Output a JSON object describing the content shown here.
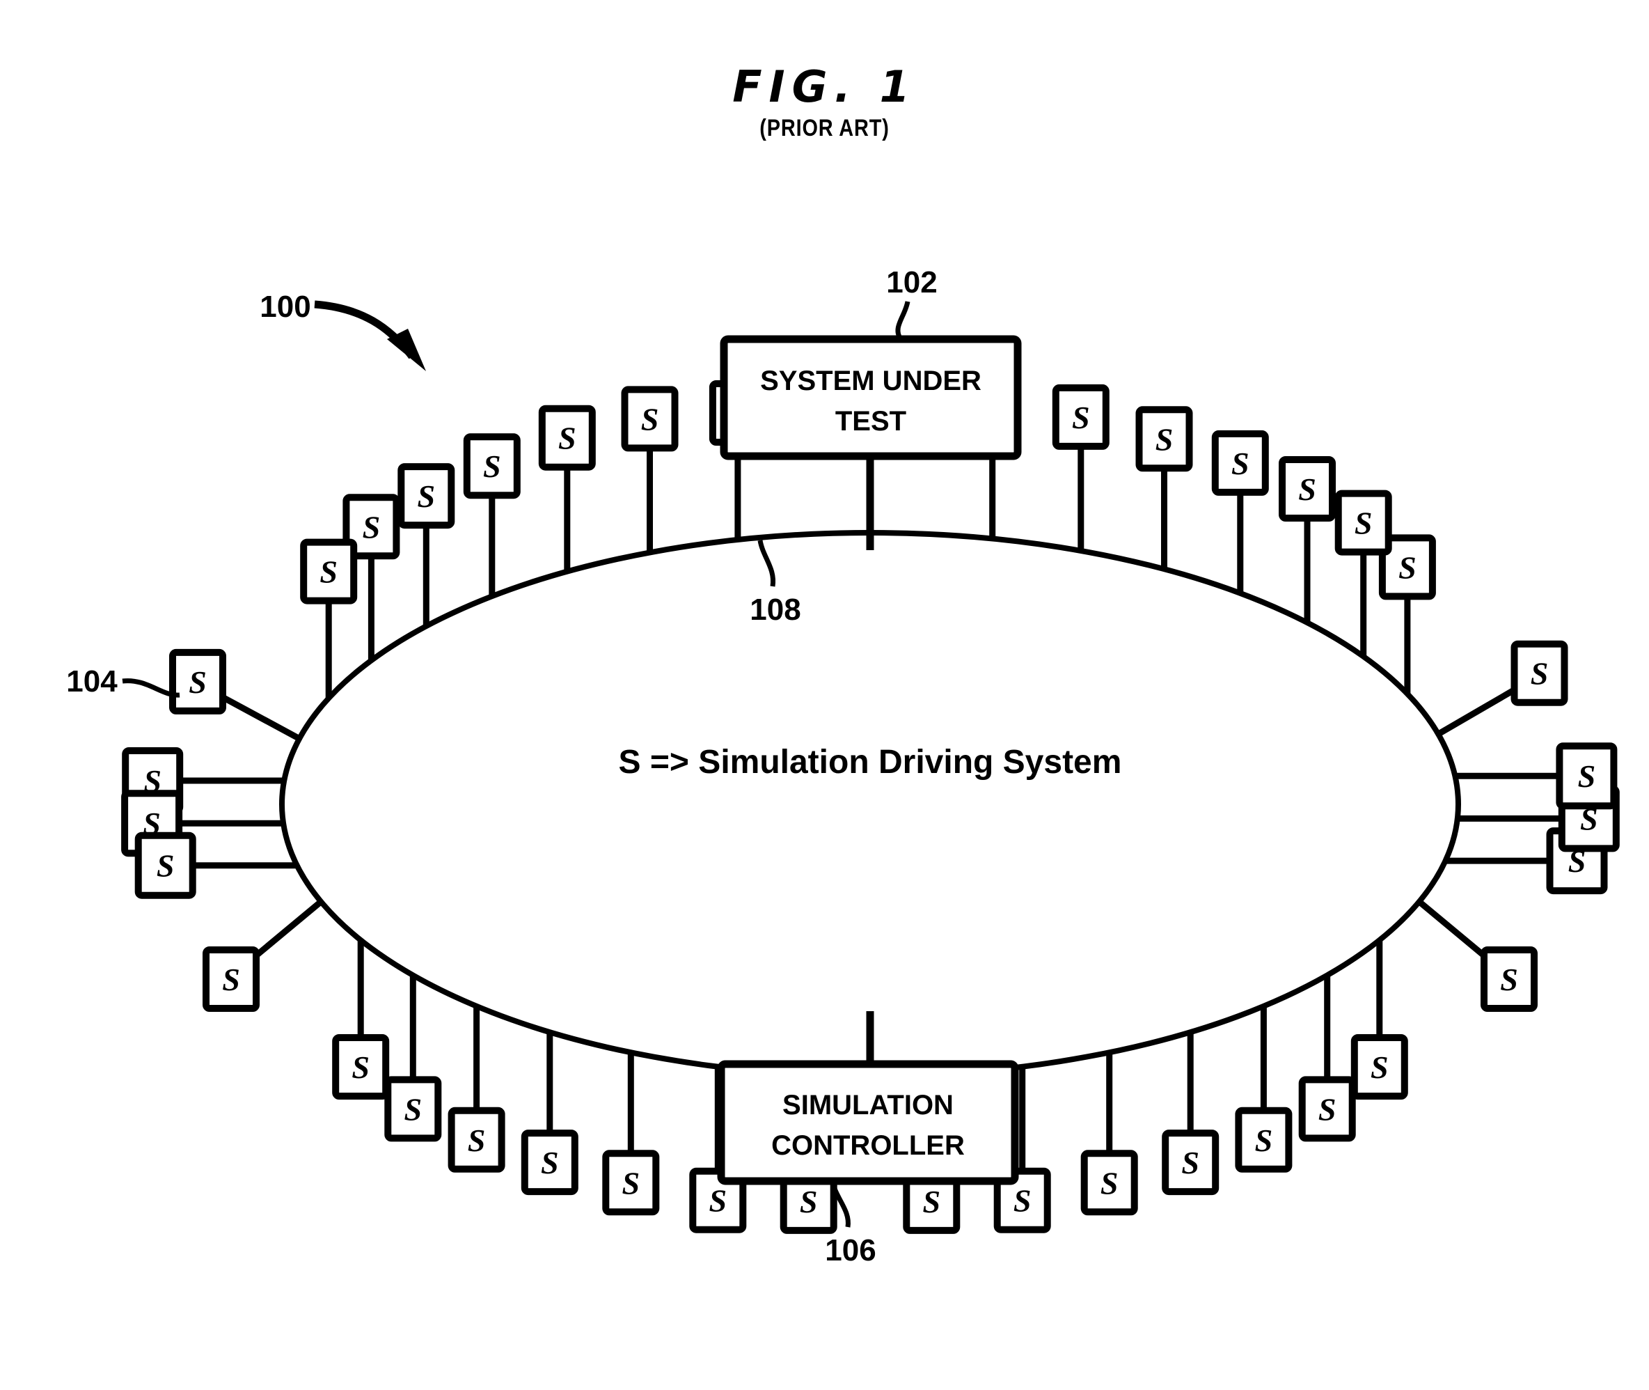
{
  "figure": {
    "title": "FIG. 1",
    "subtitle": "(PRIOR ART)"
  },
  "diagram": {
    "system_label": "100",
    "ellipse_label": "108",
    "ellipse_text": "S => Simulation Driving System",
    "node_letter": "S",
    "blocks": [
      {
        "id": "sut",
        "text_line1": "SYSTEM UNDER",
        "text_line2": "TEST",
        "ref": "102"
      },
      {
        "id": "controller",
        "text_line1": "SIMULATION",
        "text_line2": "CONTROLLER",
        "ref": "106"
      }
    ],
    "node_ref": "104",
    "node_count": 38,
    "colors": {
      "stroke": "#000000",
      "fill": "#ffffff"
    }
  }
}
